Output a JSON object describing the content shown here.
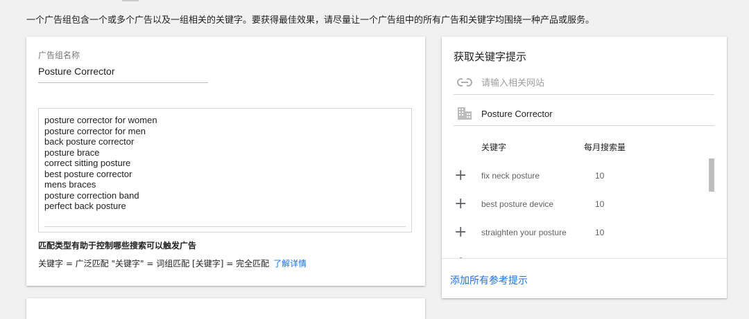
{
  "intro_text": "一个广告组包含一个或多个广告以及一组相关的关键字。要获得最佳效果，请尽量让一个广告组中的所有广告和关键字均围绕一种产品或服务。",
  "ad_group": {
    "name_label": "广告组名称",
    "name_value": "Posture Corrector",
    "keywords": [
      "posture corrector for women",
      "posture corrector for men",
      "back posture corrector",
      "posture brace",
      "correct sitting posture",
      "best posture corrector",
      "mens braces",
      "posture correction band",
      "perfect back posture"
    ],
    "match_title": "匹配类型有助于控制哪些搜索可以触发广告",
    "match_desc": "关键字 = 广泛匹配  \"关键字\" = 词组匹配  [关键字] = 完全匹配",
    "learn_more": "了解详情"
  },
  "suggestions": {
    "title": "获取关键字提示",
    "url_placeholder": "请输入相关网站",
    "product": "Posture Corrector",
    "col_keyword": "关键字",
    "col_volume": "每月搜索量",
    "rows": [
      {
        "keyword": "fix neck posture",
        "volume": "10"
      },
      {
        "keyword": "best posture device",
        "volume": "10"
      },
      {
        "keyword": "straighten your posture",
        "volume": "10"
      }
    ],
    "add_all": "添加所有参考提示"
  },
  "icons": {
    "link": "link-icon",
    "building": "building-icon",
    "plus": "plus-icon"
  },
  "colors": {
    "link_blue": "#1a73e8",
    "background": "#f1f1f1"
  }
}
